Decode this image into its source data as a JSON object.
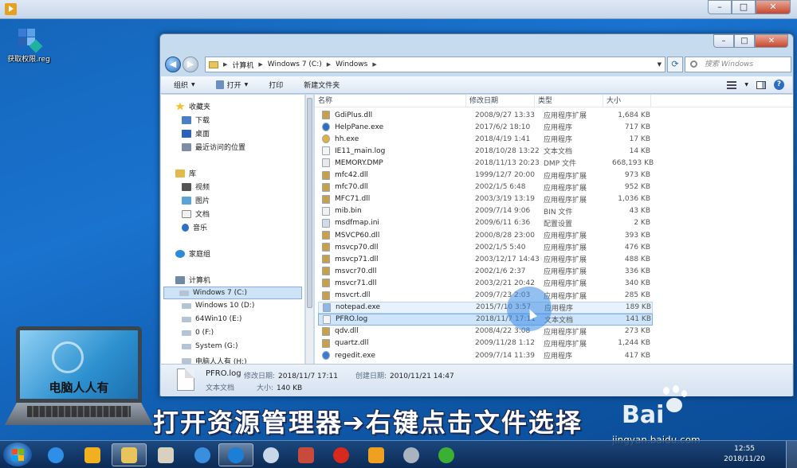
{
  "desktop": {
    "icon_label": "获取权限.reg"
  },
  "explorer": {
    "address": {
      "crumbs": [
        "计算机",
        "Windows 7 (C:)",
        "Windows"
      ]
    },
    "search_placeholder": "搜索 Windows",
    "toolbar": {
      "organize": "组织",
      "open": "打开",
      "print": "打印",
      "new_folder": "新建文件夹"
    },
    "nav": {
      "favorites": "收藏夹",
      "downloads": "下载",
      "desktop": "桌面",
      "recent": "最近访问的位置",
      "libraries": "库",
      "videos": "视频",
      "pictures": "图片",
      "documents": "文档",
      "music": "音乐",
      "homegroup": "家庭组",
      "computer": "计算机",
      "drives": [
        "Windows 7 (C:)",
        "Windows 10 (D:)",
        "64Win10 (E:)",
        "0 (F:)",
        "System (G:)",
        "电脑人人有 (H:)"
      ]
    },
    "columns": {
      "name": "名称",
      "date": "修改日期",
      "type": "类型",
      "size": "大小"
    },
    "files": [
      {
        "name": "GdiPlus.dll",
        "date": "2008/9/27 13:33",
        "type": "应用程序扩展",
        "size": "1,684 KB",
        "icon": "dll-icon"
      },
      {
        "name": "HelpPane.exe",
        "date": "2017/6/2 18:10",
        "type": "应用程序",
        "size": "717 KB",
        "icon": "help-app-icon"
      },
      {
        "name": "hh.exe",
        "date": "2018/4/19 1:41",
        "type": "应用程序",
        "size": "17 KB",
        "icon": "hh-app-icon"
      },
      {
        "name": "IE11_main.log",
        "date": "2018/10/28 13:22",
        "type": "文本文档",
        "size": "14 KB",
        "icon": "text-file-icon"
      },
      {
        "name": "MEMORY.DMP",
        "date": "2018/11/13 20:23",
        "type": "DMP 文件",
        "size": "668,193 KB",
        "icon": "dmp-file-icon"
      },
      {
        "name": "mfc42.dll",
        "date": "1999/12/7 20:00",
        "type": "应用程序扩展",
        "size": "973 KB",
        "icon": "dll-icon"
      },
      {
        "name": "mfc70.dll",
        "date": "2002/1/5 6:48",
        "type": "应用程序扩展",
        "size": "952 KB",
        "icon": "dll-icon"
      },
      {
        "name": "MFC71.dll",
        "date": "2003/3/19 13:19",
        "type": "应用程序扩展",
        "size": "1,036 KB",
        "icon": "dll-icon"
      },
      {
        "name": "mib.bin",
        "date": "2009/7/14 9:06",
        "type": "BIN 文件",
        "size": "43 KB",
        "icon": "bin-file-icon"
      },
      {
        "name": "msdfmap.ini",
        "date": "2009/6/11 6:36",
        "type": "配置设置",
        "size": "2 KB",
        "icon": "ini-file-icon"
      },
      {
        "name": "MSVCP60.dll",
        "date": "2000/8/28 23:00",
        "type": "应用程序扩展",
        "size": "393 KB",
        "icon": "dll-icon"
      },
      {
        "name": "msvcp70.dll",
        "date": "2002/1/5 5:40",
        "type": "应用程序扩展",
        "size": "476 KB",
        "icon": "dll-icon"
      },
      {
        "name": "msvcp71.dll",
        "date": "2003/12/17 14:43",
        "type": "应用程序扩展",
        "size": "488 KB",
        "icon": "dll-icon"
      },
      {
        "name": "msvcr70.dll",
        "date": "2002/1/6 2:37",
        "type": "应用程序扩展",
        "size": "336 KB",
        "icon": "dll-icon"
      },
      {
        "name": "msvcr71.dll",
        "date": "2003/2/21 20:42",
        "type": "应用程序扩展",
        "size": "340 KB",
        "icon": "dll-icon"
      },
      {
        "name": "msvcrt.dll",
        "date": "2009/7/23 2:03",
        "type": "应用程序扩展",
        "size": "285 KB",
        "icon": "dll-icon"
      },
      {
        "name": "notepad.exe",
        "date": "2015/7/10 3:57",
        "type": "应用程序",
        "size": "189 KB",
        "icon": "notepad-icon"
      },
      {
        "name": "PFRO.log",
        "date": "2018/11/7 17:11",
        "type": "文本文档",
        "size": "141 KB",
        "icon": "text-file-icon"
      },
      {
        "name": "qdv.dll",
        "date": "2008/4/22 3:08",
        "type": "应用程序扩展",
        "size": "273 KB",
        "icon": "dll-icon"
      },
      {
        "name": "quartz.dll",
        "date": "2009/11/28 1:12",
        "type": "应用程序扩展",
        "size": "1,244 KB",
        "icon": "dll-icon"
      },
      {
        "name": "regedit.exe",
        "date": "2009/7/14 11:39",
        "type": "应用程序",
        "size": "417 KB",
        "icon": "regedit-icon"
      }
    ],
    "status": {
      "file_name": "PFRO.log",
      "modified_label": "修改日期:",
      "modified_value": "2018/11/7 17:11",
      "created_label": "创建日期:",
      "created_value": "2010/11/21 14:47",
      "type_value": "文本文档",
      "size_label": "大小:",
      "size_value": "140 KB"
    }
  },
  "overlay": {
    "laptop_brand": "电脑人人有",
    "caption": "打开资源管理器➔右键点击文件选择",
    "watermark_text": "Bai",
    "watermark_url": "jingyan.baidu.com"
  },
  "taskbar": {
    "time": "12:55",
    "date": "2018/11/20"
  },
  "colors": {
    "desktop_blue": "#1a73cf",
    "selection": "#cde4fa",
    "window_frame": "#c7dbef"
  }
}
